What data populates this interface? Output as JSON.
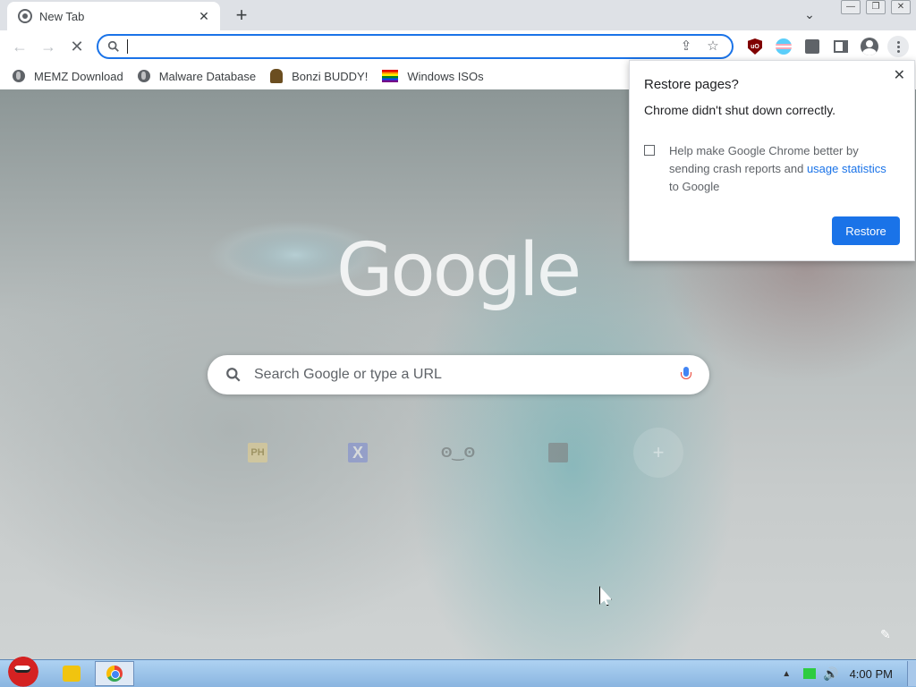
{
  "tab": {
    "title": "New Tab",
    "close": "✕",
    "new_tab": "+"
  },
  "window": {
    "tab_search": "⌄",
    "minimize": "—",
    "restore": "❐",
    "close": "✕"
  },
  "omnibox": {
    "value": ""
  },
  "bookmarks": [
    {
      "label": "MEMZ Download",
      "icon": "globe-icon"
    },
    {
      "label": "Malware Database",
      "icon": "globe-icon"
    },
    {
      "label": "Bonzi BUDDY!",
      "icon": "bonzi-icon"
    },
    {
      "label": "Windows ISOs",
      "icon": "rainbow-flag-icon"
    }
  ],
  "ntp": {
    "logo": "Google",
    "search_placeholder": "Search Google or type a URL",
    "shortcuts": [
      {
        "icon": "ph-icon",
        "glyph": "PH"
      },
      {
        "icon": "x-icon",
        "glyph": "X"
      },
      {
        "icon": "bonzi-face-icon",
        "glyph": "ʘ‿ʘ"
      },
      {
        "icon": "image-icon",
        "glyph": ""
      },
      {
        "icon": "add-shortcut-icon",
        "glyph": "+"
      }
    ],
    "edit": "✎"
  },
  "popup": {
    "title": "Restore pages?",
    "close": "✕",
    "message": "Chrome didn't shut down correctly.",
    "checkbox_text_before": "Help make Google Chrome better by sending crash reports and ",
    "checkbox_link": "usage statistics",
    "checkbox_text_after": " to Google",
    "button": "Restore"
  },
  "taskbar": {
    "clock": "4:00 PM",
    "tray_up": "▲",
    "volume": "🔊"
  },
  "colors": {
    "accent": "#1a73e8",
    "tabstrip": "#dee1e6"
  }
}
